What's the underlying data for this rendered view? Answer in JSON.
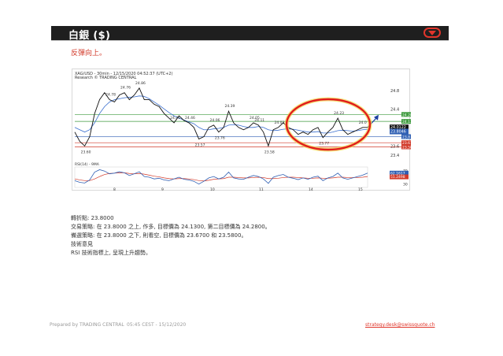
{
  "header": {
    "title": "白銀 ($)",
    "collapse_icon": "chevron-down-icon",
    "accent_color": "#e2352b"
  },
  "subtitle": "反彈向上。",
  "chart_data": {
    "type": "line",
    "header_line1": "XAG/USD - 30min - 12/15/2020 04:52:37 (UTC+2)",
    "header_line2": "Research © TRADING CENTRAL",
    "price_ticks": [
      "24.8",
      "24.4",
      "24",
      "23.6",
      "23.4"
    ],
    "levels": [
      {
        "value": 24.28,
        "label": "24.28",
        "color": "#3e9a3e"
      },
      {
        "value": 24.13,
        "label": "24.13",
        "color": "#3e9a3e"
      },
      {
        "value": 23.8,
        "label": "23.8",
        "color": "#2f5fb3"
      },
      {
        "value": 23.67,
        "label": "23.67",
        "color": "#d23a2a"
      },
      {
        "value": 23.58,
        "label": "23.58",
        "color": "#d23a2a"
      }
    ],
    "last_price_boxes": [
      "24.0122",
      "23.8046"
    ],
    "annotations": [
      "24.78",
      "24.76",
      "24.86",
      "24.41",
      "24.46",
      "24.39",
      "24.06",
      "24.05",
      "24.11",
      "24.03",
      "24.23",
      "24.0",
      "23.60",
      "23.57",
      "23.76",
      "23.58",
      "23.77"
    ],
    "price_series": [
      23.9,
      23.7,
      23.6,
      23.8,
      24.3,
      24.6,
      24.75,
      24.6,
      24.55,
      24.7,
      24.75,
      24.6,
      24.7,
      24.85,
      24.6,
      24.6,
      24.5,
      24.45,
      24.3,
      24.2,
      24.1,
      24.25,
      24.15,
      24.1,
      24.0,
      23.75,
      23.8,
      24.0,
      24.05,
      23.9,
      24.0,
      24.35,
      24.1,
      24.0,
      23.95,
      24.0,
      24.1,
      24.05,
      23.9,
      23.6,
      23.95,
      24.0,
      24.1,
      24.0,
      23.95,
      23.85,
      23.9,
      23.85,
      23.95,
      24.0,
      23.78,
      23.9,
      24.0,
      24.2,
      23.95,
      23.85,
      23.9,
      23.95,
      24.0,
      24.0
    ],
    "ma_series": [
      24.0,
      23.95,
      23.9,
      23.95,
      24.1,
      24.3,
      24.45,
      24.55,
      24.6,
      24.62,
      24.64,
      24.65,
      24.66,
      24.68,
      24.67,
      24.62,
      24.55,
      24.48,
      24.4,
      24.32,
      24.25,
      24.2,
      24.16,
      24.12,
      24.08,
      24.0,
      23.95,
      23.95,
      23.97,
      23.98,
      24.0,
      24.05,
      24.06,
      24.05,
      24.02,
      24.0,
      24.0,
      24.02,
      24.0,
      23.95,
      23.93,
      23.94,
      23.96,
      23.97,
      23.96,
      23.94,
      23.92,
      23.9,
      23.9,
      23.91,
      23.88,
      23.88,
      23.9,
      23.93,
      23.94,
      23.93,
      23.92,
      23.93,
      23.95,
      23.96
    ],
    "rsi_label": "RSI(14) - 9MA",
    "rsi_ticks": [
      "70",
      "50",
      "30"
    ],
    "rsi_boxes": [
      "62.1617",
      "51.2498"
    ],
    "rsi_series": [
      40,
      35,
      33,
      42,
      65,
      72,
      68,
      60,
      62,
      66,
      63,
      55,
      60,
      66,
      52,
      50,
      45,
      47,
      42,
      40,
      45,
      50,
      44,
      42,
      38,
      30,
      38,
      48,
      52,
      45,
      50,
      65,
      48,
      45,
      44,
      50,
      55,
      52,
      45,
      32,
      50,
      55,
      58,
      50,
      47,
      43,
      48,
      44,
      50,
      53,
      40,
      48,
      52,
      62,
      48,
      44,
      48,
      52,
      56,
      62
    ],
    "rsi_ma_series": [
      45,
      42,
      40,
      40,
      45,
      52,
      58,
      61,
      62,
      63,
      63,
      61,
      60,
      61,
      59,
      56,
      53,
      51,
      48,
      46,
      45,
      46,
      46,
      45,
      43,
      40,
      39,
      41,
      44,
      45,
      46,
      50,
      50,
      49,
      48,
      48,
      49,
      50,
      49,
      46,
      46,
      47,
      49,
      50,
      50,
      49,
      48,
      47,
      47,
      48,
      47,
      47,
      48,
      50,
      50,
      49,
      49,
      49,
      50,
      52
    ],
    "date_ticks": [
      "8",
      "9",
      "10",
      "11",
      "14",
      "15"
    ]
  },
  "info": {
    "pivot_label": "轉折點: 23.8000",
    "strategy": "交易策略: 在 23.8000 之上, 作多, 目標價為 24.1300, 第二目標價為 24.2800。",
    "alternative": "備選策略: 在 23.8000 之下, 則看空, 目標價為 23.6700 和 23.5800。",
    "comment_title": "技術意見",
    "comment": "RSI 技術指標上, 呈現上升趨勢。"
  },
  "footer": {
    "prepared_by": "Prepared by TRADING CENTRAL",
    "timestamp": "05:45 CEST - 15/12/2020",
    "email": "strategy.desk@swissquote.ch"
  }
}
